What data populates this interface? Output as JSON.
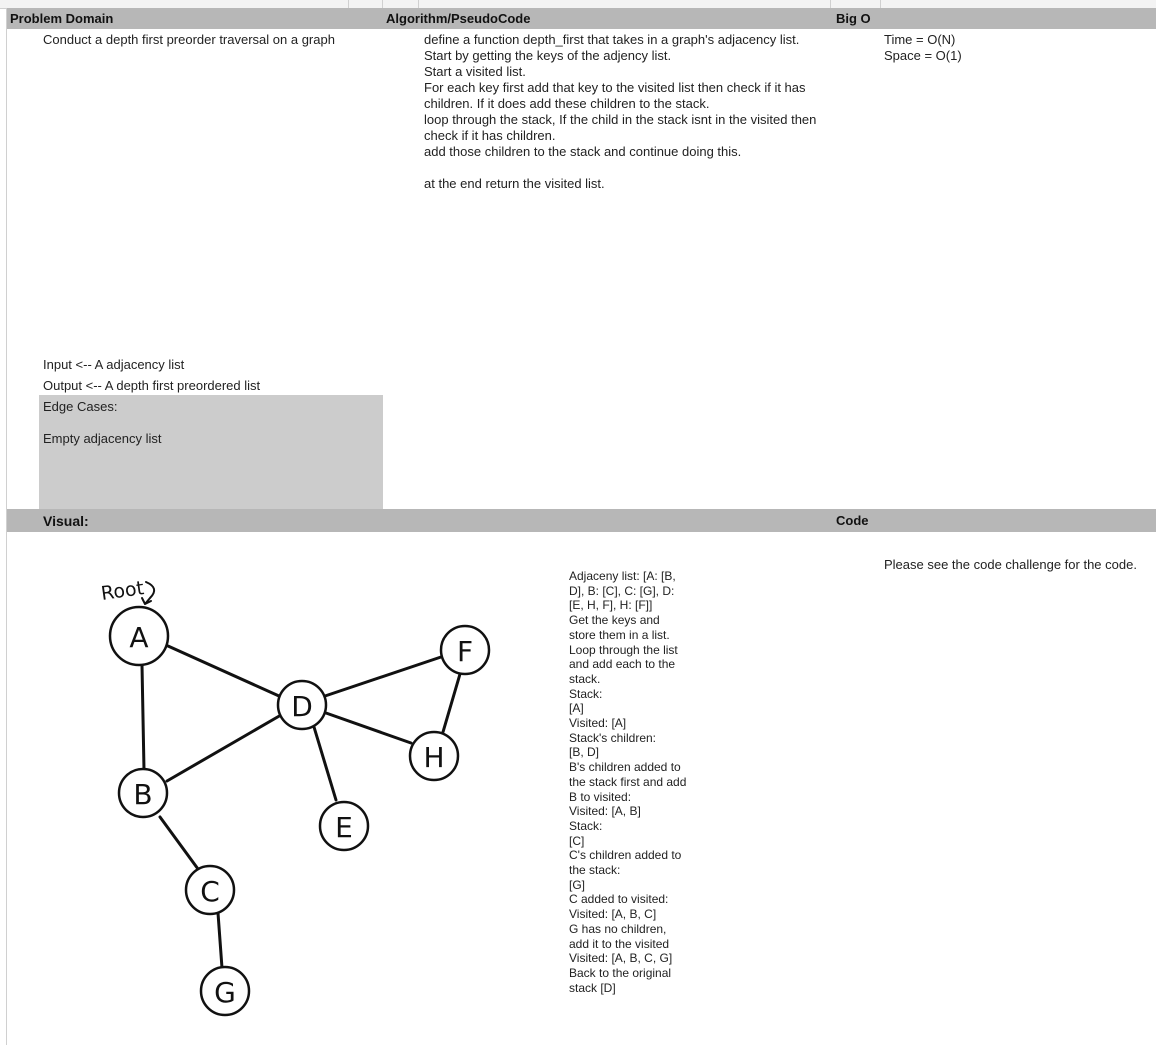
{
  "header": {
    "problem_domain": "Problem Domain",
    "algorithm": "Algorithm/PseudoCode",
    "big_o": "Big O"
  },
  "problem": {
    "description": "Conduct a depth first preorder traversal on a graph",
    "input": "Input <-- A adjacency list",
    "output": "Output <--  A depth first preordered list",
    "edge_cases_label": "Edge Cases:",
    "edge_case_1": "Empty adjacency list"
  },
  "algorithm": {
    "lines": [
      "define a function depth_first that takes in a graph's adjacency list.",
      "Start by getting the keys of the adjency list.",
      "Start a visited list.",
      "For each key first add that key to the visited list then check if it has",
      "children. If it does add these children to the stack.",
      "loop through the stack, If the child in the stack isnt in the visited then",
      "check if it has children.",
      "add those children to the stack and continue doing this.",
      "",
      "at the end return the visited list."
    ]
  },
  "big_o": {
    "time": "Time = O(N)",
    "space": "Space = O(1)"
  },
  "section2": {
    "visual": "Visual:",
    "code": "Code"
  },
  "code_note": "Please see the code challenge for the code.",
  "walkthrough": {
    "lines": [
      "Adjaceny list: [A: [B,",
      "D], B: [C], C: [G], D:",
      "[E, H, F], H: [F]]",
      "Get the keys and",
      "store them in a list.",
      "Loop through the list",
      "and add each to the",
      "stack.",
      "Stack:",
      "[A]",
      "Visited: [A]",
      "Stack's children:",
      "[B, D]",
      "B's children added to",
      "the stack first and add",
      "B to visited:",
      "Visited: [A, B]",
      "Stack:",
      "[C]",
      "C's children added to",
      "the stack:",
      "[G]",
      "C added to visited:",
      "Visited: [A, B, C]",
      "G has no children,",
      "add it to the visited",
      "Visited: [A, B, C, G]",
      "Back to the original",
      "stack [D]"
    ]
  },
  "graph": {
    "root_label": "Root",
    "nodes": [
      "A",
      "B",
      "C",
      "D",
      "E",
      "F",
      "G",
      "H"
    ],
    "edges": [
      [
        "A",
        "B"
      ],
      [
        "A",
        "D"
      ],
      [
        "B",
        "D"
      ],
      [
        "B",
        "C"
      ],
      [
        "C",
        "G"
      ],
      [
        "D",
        "F"
      ],
      [
        "D",
        "H"
      ],
      [
        "D",
        "E"
      ],
      [
        "F",
        "H"
      ]
    ]
  }
}
